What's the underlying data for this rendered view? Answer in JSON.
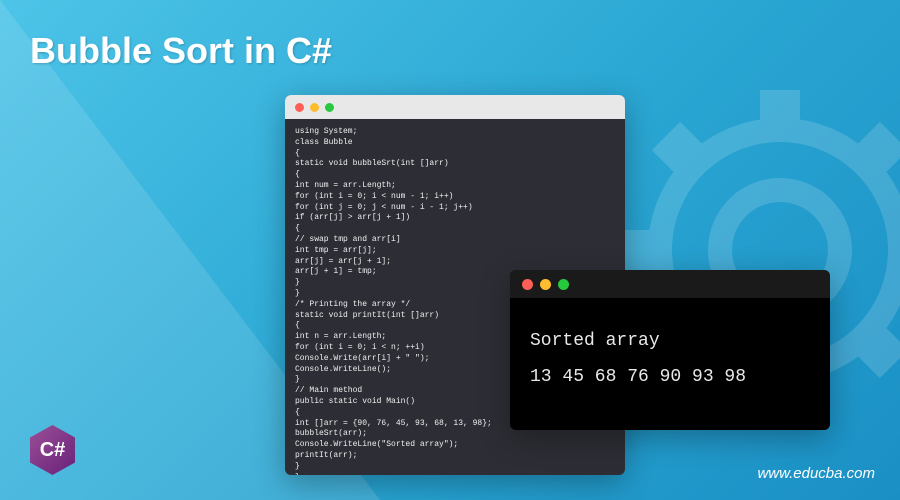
{
  "title": "Bubble Sort in C#",
  "code": {
    "lines": "using System;\nclass Bubble\n{\nstatic void bubbleSrt(int []arr)\n{\nint num = arr.Length;\nfor (int i = 0; i < num - 1; i++)\nfor (int j = 0; j < num - i - 1; j++)\nif (arr[j] > arr[j + 1])\n{\n// swap tmp and arr[i]\nint tmp = arr[j];\narr[j] = arr[j + 1];\narr[j + 1] = tmp;\n}\n}\n/* Printing the array */\nstatic void printIt(int []arr)\n{\nint n = arr.Length;\nfor (int i = 0; i < n; ++i)\nConsole.Write(arr[i] + \" \");\nConsole.WriteLine();\n}\n// Main method\npublic static void Main()\n{\nint []arr = {90, 76, 45, 93, 68, 13, 98};\nbubbleSrt(arr);\nConsole.WriteLine(\"Sorted array\");\nprintIt(arr);\n}\n}"
  },
  "output": {
    "line1": "Sorted array",
    "line2": "13  45  68  76  90  93  98"
  },
  "logo": {
    "text": "C#"
  },
  "footer": {
    "url": "www.educba.com"
  }
}
